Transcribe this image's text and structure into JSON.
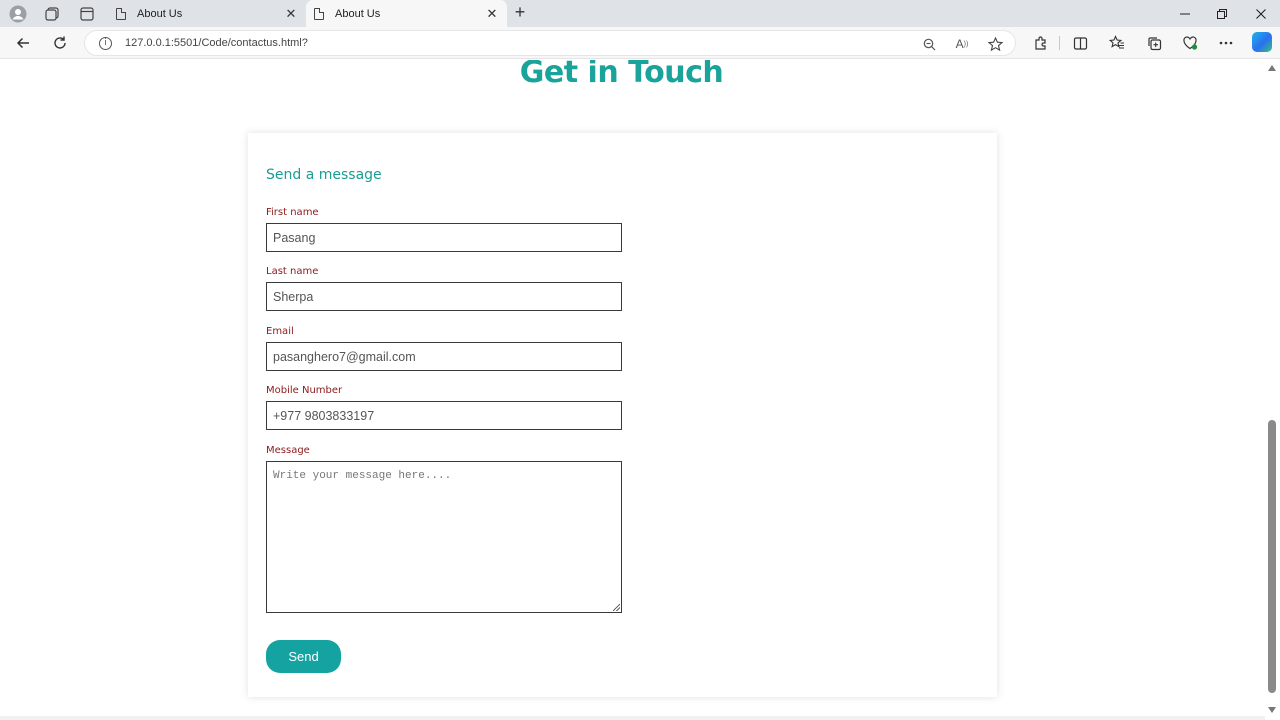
{
  "browser": {
    "tabs": [
      {
        "title": "About Us",
        "active": false
      },
      {
        "title": "About Us",
        "active": true
      }
    ],
    "url": "127.0.0.1:5501/Code/contactus.html?",
    "icons": {
      "profile": "profile-icon",
      "workspaces": "workspaces-icon",
      "tab_actions": "tab-actions-icon",
      "back": "back-arrow-icon",
      "refresh": "refresh-icon",
      "info": "info-icon",
      "zoom": "zoom-out-icon",
      "read_aloud": "read-aloud-icon",
      "favorite": "star-icon",
      "extensions": "extensions-icon",
      "split_screen": "split-screen-icon",
      "favorites": "favorites-icon",
      "collections": "collections-icon",
      "performance": "heart-icon",
      "more": "more-icon",
      "copilot": "copilot-icon"
    }
  },
  "page": {
    "heading": "Get in Touch",
    "form": {
      "subtitle": "Send a message",
      "first_name_label": "First name",
      "first_name_value": "Pasang",
      "last_name_label": "Last name",
      "last_name_value": "Sherpa",
      "email_label": "Email",
      "email_value": "pasanghero7@gmail.com",
      "mobile_label": "Mobile Number",
      "mobile_value": "+977 9803833197",
      "message_label": "Message",
      "message_placeholder": "Write your message here....",
      "send_label": "Send"
    }
  },
  "colors": {
    "accent": "#1aa39a",
    "button": "#14a3a0",
    "label": "#8b1a1a"
  }
}
